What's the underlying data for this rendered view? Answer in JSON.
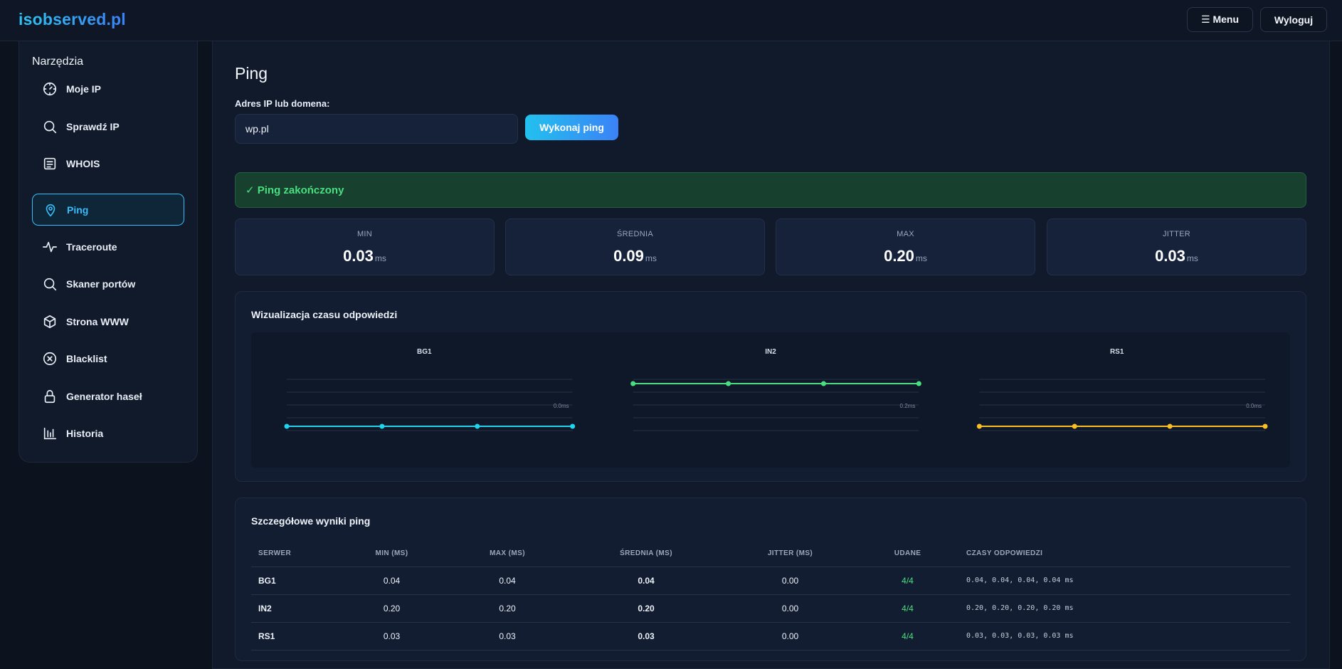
{
  "header": {
    "logo": "isobserved.pl",
    "menu_label": "☰ Menu",
    "logout_label": "Wyloguj"
  },
  "sidebar": {
    "title": "Narzędzia",
    "items": [
      {
        "label": "Moje IP",
        "icon": "dial-icon"
      },
      {
        "label": "Sprawdź IP",
        "icon": "search-icon"
      },
      {
        "label": "WHOIS",
        "icon": "document-icon"
      },
      {
        "label": "Ping",
        "icon": "map-pin-icon",
        "active": true
      },
      {
        "label": "Traceroute",
        "icon": "activity-icon"
      },
      {
        "label": "Skaner portów",
        "icon": "search-icon"
      },
      {
        "label": "Strona WWW",
        "icon": "cube-icon"
      },
      {
        "label": "Blacklist",
        "icon": "x-circle-icon"
      },
      {
        "label": "Generator haseł",
        "icon": "lock-icon"
      },
      {
        "label": "Historia",
        "icon": "bar-chart-icon"
      }
    ]
  },
  "main": {
    "title": "Ping",
    "field_label": "Adres IP lub domena:",
    "input_value": "wp.pl",
    "button_label": "Wykonaj ping",
    "alert": "✓ Ping zakończony",
    "stats": [
      {
        "label": "MIN",
        "value": "0.03",
        "unit": "ms"
      },
      {
        "label": "ŚREDNIA",
        "value": "0.09",
        "unit": "ms"
      },
      {
        "label": "MAX",
        "value": "0.20",
        "unit": "ms"
      },
      {
        "label": "JITTER",
        "value": "0.03",
        "unit": "ms"
      }
    ],
    "viz_title": "Wizualizacja czasu odpowiedzi",
    "table_title": "Szczegółowe wyniki ping",
    "table": {
      "headers": [
        "SERWER",
        "MIN (MS)",
        "MAX (MS)",
        "ŚREDNIA (MS)",
        "JITTER (MS)",
        "UDANE",
        "CZASY ODPOWIEDZI"
      ],
      "rows": [
        {
          "server": "BG1",
          "min": "0.04",
          "max": "0.04",
          "avg": "0.04",
          "jitter": "0.00",
          "ok": "4/4",
          "times": "0.04, 0.04, 0.04, 0.04 ms"
        },
        {
          "server": "IN2",
          "min": "0.20",
          "max": "0.20",
          "avg": "0.20",
          "jitter": "0.00",
          "ok": "4/4",
          "times": "0.20, 0.20, 0.20, 0.20 ms"
        },
        {
          "server": "RS1",
          "min": "0.03",
          "max": "0.03",
          "avg": "0.03",
          "jitter": "0.00",
          "ok": "4/4",
          "times": "0.03, 0.03, 0.03, 0.03 ms"
        }
      ]
    }
  },
  "colors": {
    "accent": "#38bdf8",
    "success": "#4ade80",
    "bg": "#0c131f",
    "panel": "#111a2b"
  },
  "chart_data": [
    {
      "type": "line",
      "title": "BG1",
      "x": [
        1,
        2,
        3,
        4
      ],
      "values": [
        0.04,
        0.04,
        0.04,
        0.04
      ],
      "scale_label": "0.0ms",
      "color": "#22d3ee"
    },
    {
      "type": "line",
      "title": "IN2",
      "x": [
        1,
        2,
        3,
        4
      ],
      "values": [
        0.2,
        0.2,
        0.2,
        0.2
      ],
      "scale_label": "0.2ms",
      "color": "#4ade80"
    },
    {
      "type": "line",
      "title": "RS1",
      "x": [
        1,
        2,
        3,
        4
      ],
      "values": [
        0.03,
        0.03,
        0.03,
        0.03
      ],
      "scale_label": "0.0ms",
      "color": "#fbbf24"
    }
  ]
}
